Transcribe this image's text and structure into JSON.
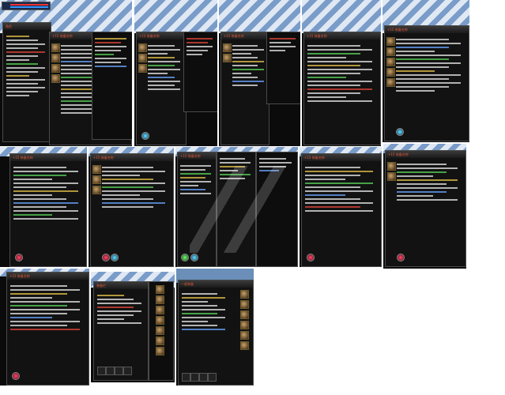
{
  "screenshots": {
    "row1": [
      {
        "title": "+15 装备名称",
        "subtitle": "装备强化属性"
      },
      {
        "title": "+15 装备名称",
        "subtitle": "装备强化属性"
      },
      {
        "title": "+15 装备名称",
        "subtitle": "装备强化属性"
      },
      {
        "title": "+15 装备名称",
        "subtitle": "装备强化属性"
      },
      {
        "title": "+15 装备名称",
        "subtitle": "装备强化属性"
      }
    ],
    "row2": [
      {
        "title": "+15 装备名称"
      },
      {
        "title": "+15 装备名称"
      },
      {
        "title": "+15 装备名称"
      },
      {
        "title": "+15 装备名称"
      },
      {
        "title": "+15 装备名称"
      }
    ],
    "row3": [
      {
        "title": "+15 装备名称"
      },
      {
        "title": "装备栏"
      },
      {
        "title": "一般装备"
      }
    ]
  },
  "char_panel": {
    "title": "角色"
  },
  "colors": {
    "accent": "#e05a3a",
    "gold": "#e6c34a",
    "green": "#5ad15a",
    "blue": "#6aa6ff"
  }
}
